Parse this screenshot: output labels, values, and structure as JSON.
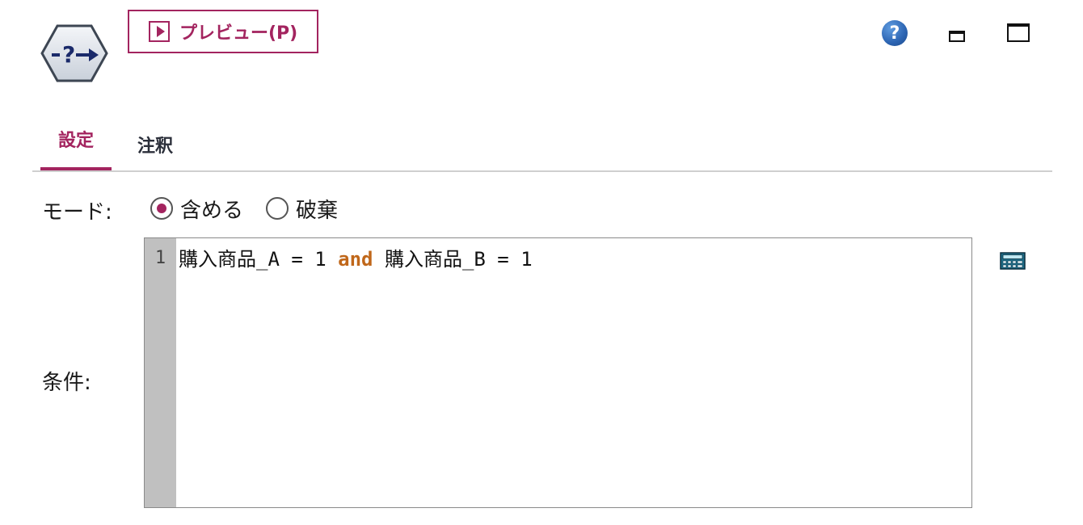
{
  "node": {
    "icon": "select-node-icon"
  },
  "toolbar": {
    "preview_label": "プレビュー(P)",
    "help_label": "?"
  },
  "tabs": [
    {
      "label": "設定",
      "active": true
    },
    {
      "label": "注釈",
      "active": false
    }
  ],
  "mode": {
    "label": "モード:",
    "options": [
      {
        "label": "含める",
        "selected": true
      },
      {
        "label": "破棄",
        "selected": false
      }
    ]
  },
  "condition": {
    "label": "条件:",
    "line_number": "1",
    "tokens": [
      {
        "text": "購入商品_A = 1 ",
        "keyword": false
      },
      {
        "text": "and",
        "keyword": true
      },
      {
        "text": " 購入商品_B = 1",
        "keyword": false
      }
    ]
  },
  "colors": {
    "accent": "#a3245f",
    "keyword": "#c0671a",
    "gutter": "#c0c0c0"
  }
}
